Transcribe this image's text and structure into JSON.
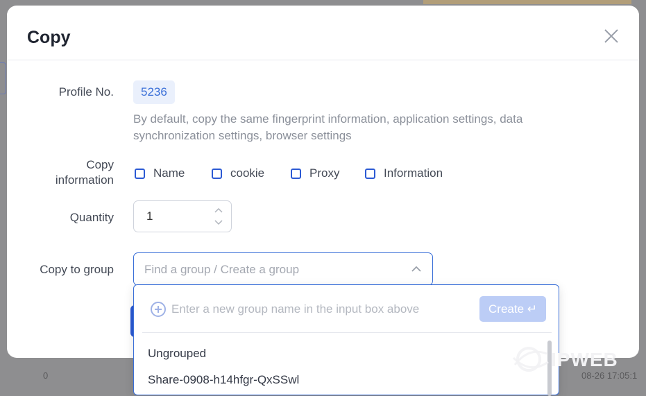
{
  "dialog": {
    "title": "Copy"
  },
  "profile": {
    "label": "Profile No.",
    "number": "5236",
    "hint": "By default, copy the same fingerprint information, application settings, data synchronization settings, browser settings"
  },
  "copy_information": {
    "label_line1": "Copy",
    "label_line2": "information",
    "options": [
      "Name",
      "cookie",
      "Proxy",
      "Information"
    ]
  },
  "quantity": {
    "label": "Quantity",
    "value": "1"
  },
  "group": {
    "label": "Copy to group",
    "placeholder": "Find a group / Create a group",
    "dropdown": {
      "hint": "Enter a new group name in the input box above",
      "create_label": "Create ↵",
      "items": [
        "Ungrouped",
        "Share-0908-h14hfgr-QxSSwl"
      ]
    }
  },
  "background": {
    "left_bottom": "0",
    "right_bottom": "08-26 17:05:1"
  },
  "watermark": {
    "text": "IPWEB"
  },
  "colors": {
    "accent": "#2c5ad4",
    "badge_bg": "#eaf0fc",
    "create_disabled": "#bccdf6"
  }
}
